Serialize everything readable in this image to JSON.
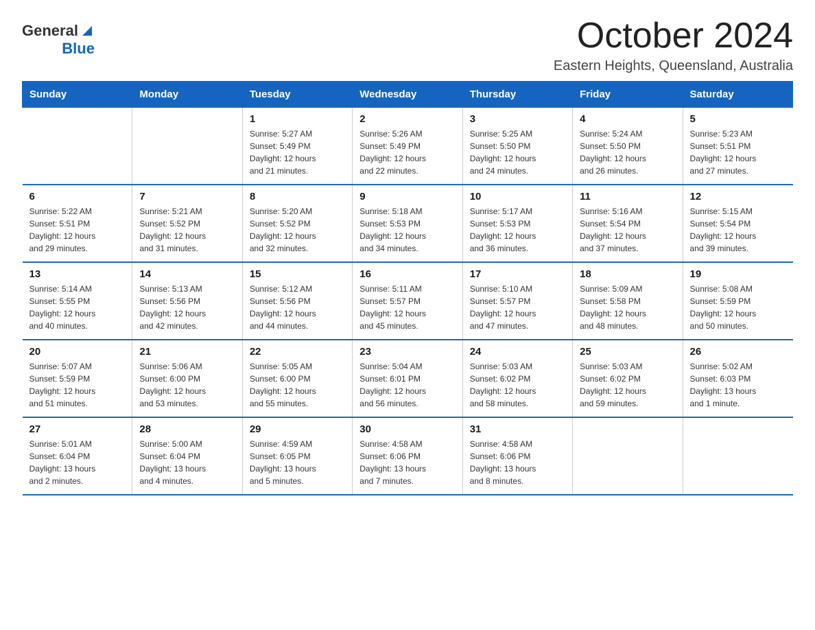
{
  "logo": {
    "general": "General",
    "blue": "Blue"
  },
  "header": {
    "month": "October 2024",
    "location": "Eastern Heights, Queensland, Australia"
  },
  "weekdays": [
    "Sunday",
    "Monday",
    "Tuesday",
    "Wednesday",
    "Thursday",
    "Friday",
    "Saturday"
  ],
  "weeks": [
    [
      {
        "day": "",
        "info": ""
      },
      {
        "day": "",
        "info": ""
      },
      {
        "day": "1",
        "info": "Sunrise: 5:27 AM\nSunset: 5:49 PM\nDaylight: 12 hours\nand 21 minutes."
      },
      {
        "day": "2",
        "info": "Sunrise: 5:26 AM\nSunset: 5:49 PM\nDaylight: 12 hours\nand 22 minutes."
      },
      {
        "day": "3",
        "info": "Sunrise: 5:25 AM\nSunset: 5:50 PM\nDaylight: 12 hours\nand 24 minutes."
      },
      {
        "day": "4",
        "info": "Sunrise: 5:24 AM\nSunset: 5:50 PM\nDaylight: 12 hours\nand 26 minutes."
      },
      {
        "day": "5",
        "info": "Sunrise: 5:23 AM\nSunset: 5:51 PM\nDaylight: 12 hours\nand 27 minutes."
      }
    ],
    [
      {
        "day": "6",
        "info": "Sunrise: 5:22 AM\nSunset: 5:51 PM\nDaylight: 12 hours\nand 29 minutes."
      },
      {
        "day": "7",
        "info": "Sunrise: 5:21 AM\nSunset: 5:52 PM\nDaylight: 12 hours\nand 31 minutes."
      },
      {
        "day": "8",
        "info": "Sunrise: 5:20 AM\nSunset: 5:52 PM\nDaylight: 12 hours\nand 32 minutes."
      },
      {
        "day": "9",
        "info": "Sunrise: 5:18 AM\nSunset: 5:53 PM\nDaylight: 12 hours\nand 34 minutes."
      },
      {
        "day": "10",
        "info": "Sunrise: 5:17 AM\nSunset: 5:53 PM\nDaylight: 12 hours\nand 36 minutes."
      },
      {
        "day": "11",
        "info": "Sunrise: 5:16 AM\nSunset: 5:54 PM\nDaylight: 12 hours\nand 37 minutes."
      },
      {
        "day": "12",
        "info": "Sunrise: 5:15 AM\nSunset: 5:54 PM\nDaylight: 12 hours\nand 39 minutes."
      }
    ],
    [
      {
        "day": "13",
        "info": "Sunrise: 5:14 AM\nSunset: 5:55 PM\nDaylight: 12 hours\nand 40 minutes."
      },
      {
        "day": "14",
        "info": "Sunrise: 5:13 AM\nSunset: 5:56 PM\nDaylight: 12 hours\nand 42 minutes."
      },
      {
        "day": "15",
        "info": "Sunrise: 5:12 AM\nSunset: 5:56 PM\nDaylight: 12 hours\nand 44 minutes."
      },
      {
        "day": "16",
        "info": "Sunrise: 5:11 AM\nSunset: 5:57 PM\nDaylight: 12 hours\nand 45 minutes."
      },
      {
        "day": "17",
        "info": "Sunrise: 5:10 AM\nSunset: 5:57 PM\nDaylight: 12 hours\nand 47 minutes."
      },
      {
        "day": "18",
        "info": "Sunrise: 5:09 AM\nSunset: 5:58 PM\nDaylight: 12 hours\nand 48 minutes."
      },
      {
        "day": "19",
        "info": "Sunrise: 5:08 AM\nSunset: 5:59 PM\nDaylight: 12 hours\nand 50 minutes."
      }
    ],
    [
      {
        "day": "20",
        "info": "Sunrise: 5:07 AM\nSunset: 5:59 PM\nDaylight: 12 hours\nand 51 minutes."
      },
      {
        "day": "21",
        "info": "Sunrise: 5:06 AM\nSunset: 6:00 PM\nDaylight: 12 hours\nand 53 minutes."
      },
      {
        "day": "22",
        "info": "Sunrise: 5:05 AM\nSunset: 6:00 PM\nDaylight: 12 hours\nand 55 minutes."
      },
      {
        "day": "23",
        "info": "Sunrise: 5:04 AM\nSunset: 6:01 PM\nDaylight: 12 hours\nand 56 minutes."
      },
      {
        "day": "24",
        "info": "Sunrise: 5:03 AM\nSunset: 6:02 PM\nDaylight: 12 hours\nand 58 minutes."
      },
      {
        "day": "25",
        "info": "Sunrise: 5:03 AM\nSunset: 6:02 PM\nDaylight: 12 hours\nand 59 minutes."
      },
      {
        "day": "26",
        "info": "Sunrise: 5:02 AM\nSunset: 6:03 PM\nDaylight: 13 hours\nand 1 minute."
      }
    ],
    [
      {
        "day": "27",
        "info": "Sunrise: 5:01 AM\nSunset: 6:04 PM\nDaylight: 13 hours\nand 2 minutes."
      },
      {
        "day": "28",
        "info": "Sunrise: 5:00 AM\nSunset: 6:04 PM\nDaylight: 13 hours\nand 4 minutes."
      },
      {
        "day": "29",
        "info": "Sunrise: 4:59 AM\nSunset: 6:05 PM\nDaylight: 13 hours\nand 5 minutes."
      },
      {
        "day": "30",
        "info": "Sunrise: 4:58 AM\nSunset: 6:06 PM\nDaylight: 13 hours\nand 7 minutes."
      },
      {
        "day": "31",
        "info": "Sunrise: 4:58 AM\nSunset: 6:06 PM\nDaylight: 13 hours\nand 8 minutes."
      },
      {
        "day": "",
        "info": ""
      },
      {
        "day": "",
        "info": ""
      }
    ]
  ]
}
